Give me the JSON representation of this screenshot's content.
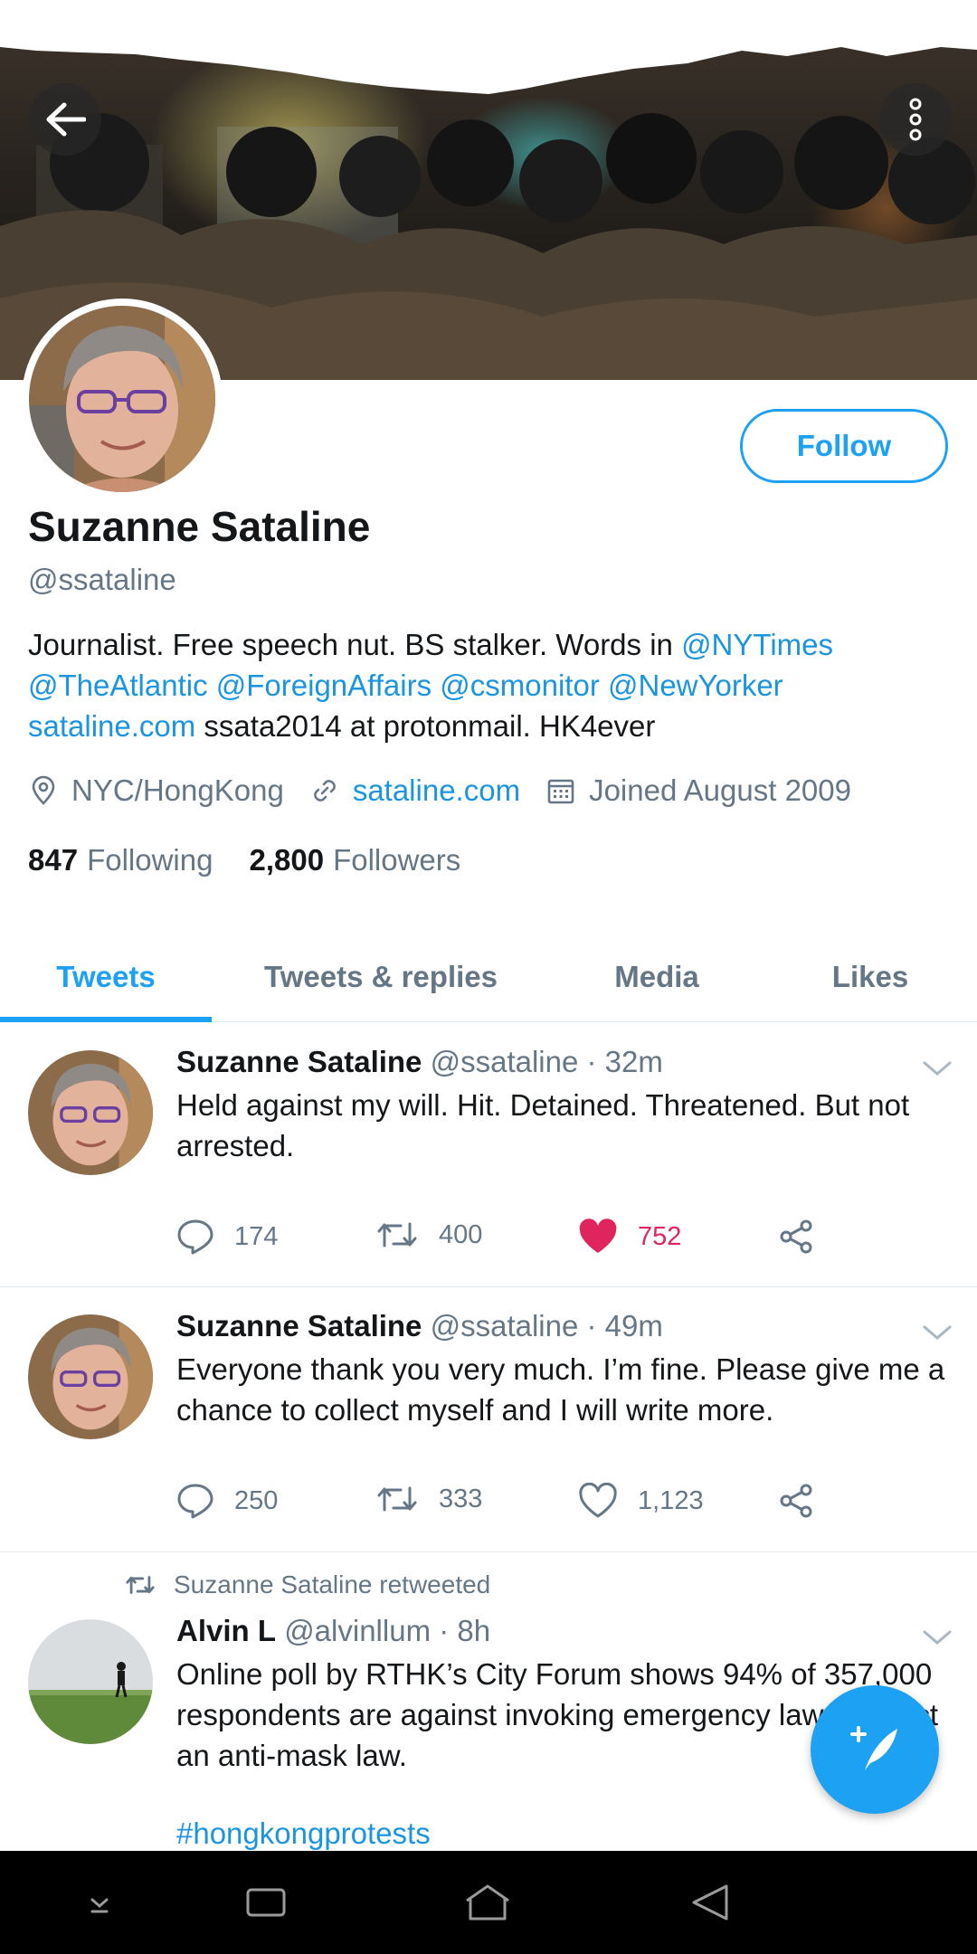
{
  "header": {
    "back_icon": "arrow-left-icon",
    "more_icon": "more-vertical-icon"
  },
  "profile": {
    "name": "Suzanne Sataline",
    "handle": "@ssataline",
    "follow_label": "Follow",
    "bio": {
      "line1_text": "Journalist. Free speech nut. BS stalker. Words in ",
      "line1_link": "@NYTimes",
      "line2_links": [
        "@TheAtlantic",
        "@ForeignAffairs",
        "@csmonitor",
        "@NewYorker"
      ],
      "line3_link": "sataline.com",
      "line3_text": " ssata2014 at protonmail. HK4ever"
    },
    "location": "NYC/HongKong",
    "website": "sataline.com",
    "joined": "Joined August 2009",
    "following_count": "847",
    "following_label": "Following",
    "followers_count": "2,800",
    "followers_label": "Followers"
  },
  "tabs": [
    {
      "label": "Tweets",
      "active": true
    },
    {
      "label": "Tweets & replies",
      "active": false
    },
    {
      "label": "Media",
      "active": false
    },
    {
      "label": "Likes",
      "active": false
    }
  ],
  "tweets": [
    {
      "name": "Suzanne Sataline",
      "handle": "@ssataline",
      "time": "· 32m",
      "text": "Held against my will. Hit. Detained. Threatened. But not arrested.",
      "replies": "174",
      "retweets": "400",
      "likes": "752",
      "liked": true
    },
    {
      "name": "Suzanne Sataline",
      "handle": "@ssataline",
      "time": "· 49m",
      "text": "Everyone thank you very much. I’m fine. Please give me a chance to collect myself and I will write more.",
      "replies": "250",
      "retweets": "333",
      "likes": "1,123",
      "liked": false
    },
    {
      "retweeted_by": "Suzanne Sataline retweeted",
      "name": "Alvin L",
      "handle": "@alvinllum",
      "time": "· 8h",
      "text": "Online poll by RTHK’s City Forum shows 94% of 357,000 respondents are against invoking emergency law to enact an anti-mask law.",
      "hashtag": "#hongkongprotests"
    }
  ],
  "colors": {
    "accent": "#1da1f2",
    "link": "#1b95e0",
    "like": "#e0245e",
    "secondary_text": "#657786"
  }
}
